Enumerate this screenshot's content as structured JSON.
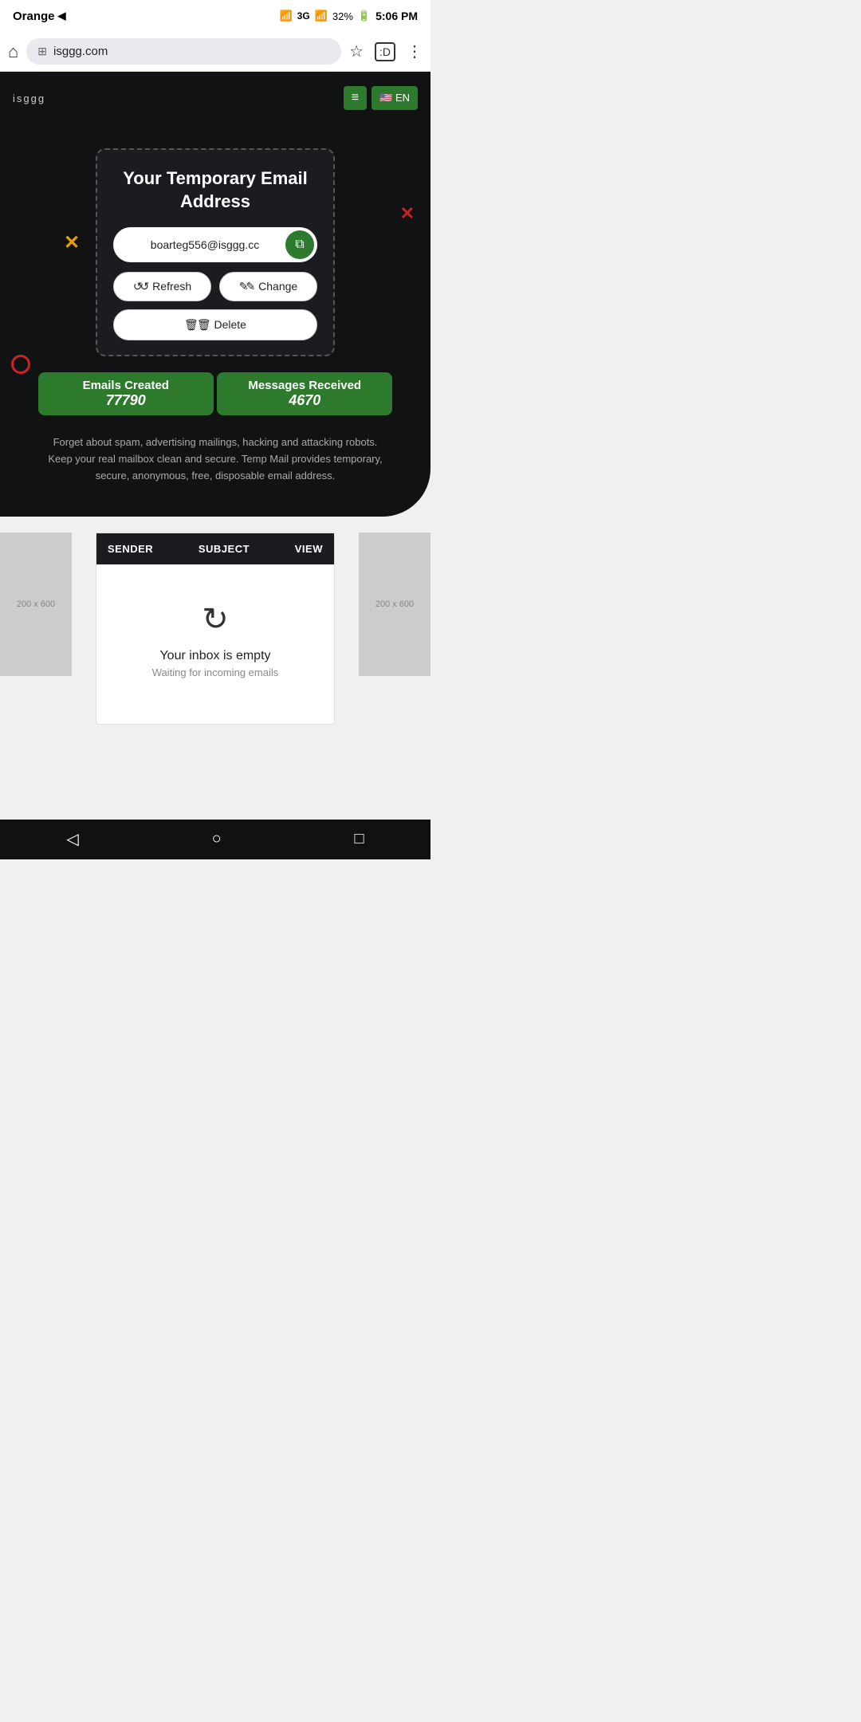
{
  "status_bar": {
    "carrier": "Orange",
    "send_icon": "◀",
    "wifi": "WiFi",
    "signal": "3G",
    "battery": "32%",
    "time": "5:06 PM"
  },
  "browser": {
    "url": "isggg.com",
    "home_icon": "⌂",
    "star_icon": "☆",
    "devtools_icon": ":D",
    "more_icon": "⋮"
  },
  "nav": {
    "logo": "isggg",
    "menu_icon": "≡",
    "lang": "🇺🇸 EN"
  },
  "deco": {
    "x_left": "✕",
    "x_right": "✕"
  },
  "email_card": {
    "title": "Your Temporary Email Address",
    "email_value": "boarteg556@isggg.cc",
    "copy_icon": "⧉",
    "refresh_label": "↺ Refresh",
    "change_label": "✎ Change",
    "delete_label": "🗑 Delete"
  },
  "stats": {
    "emails_created_label": "Emails Created",
    "emails_created_value": "77790",
    "messages_received_label": "Messages Received",
    "messages_received_value": "4670"
  },
  "description": "Forget about spam, advertising mailings, hacking and attacking robots. Keep your real mailbox clean and secure. Temp Mail provides temporary, secure, anonymous, free, disposable email address.",
  "inbox": {
    "col_sender": "SENDER",
    "col_subject": "SUBJECT",
    "col_view": "VIEW",
    "empty_title": "Your inbox is empty",
    "empty_sub": "Waiting for incoming emails",
    "ad_size": "200 x 600"
  },
  "android_nav": {
    "back": "◁",
    "home": "○",
    "recents": "□"
  }
}
